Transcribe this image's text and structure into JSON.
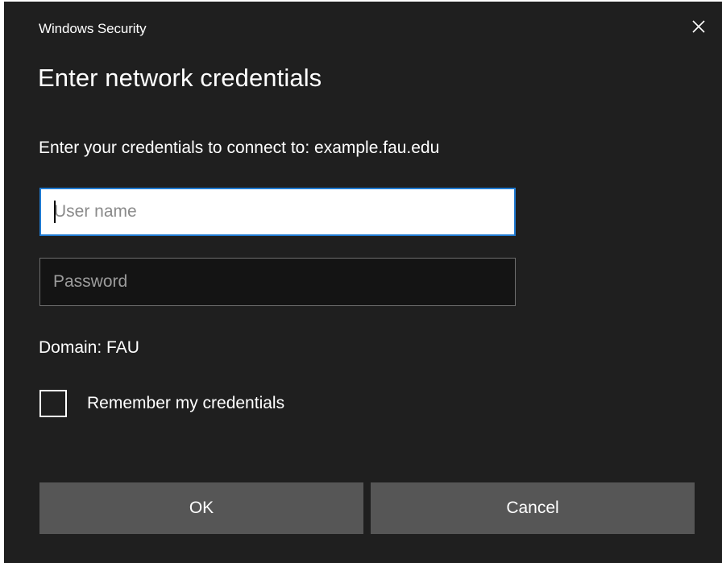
{
  "window": {
    "title": "Windows Security",
    "close_icon": "close-icon"
  },
  "dialog": {
    "heading": "Enter network credentials",
    "prompt": "Enter your credentials to connect to: example.fau.edu",
    "username": {
      "value": "",
      "placeholder": "User name"
    },
    "password": {
      "value": "",
      "placeholder": "Password"
    },
    "domain": "Domain: FAU",
    "remember": {
      "label": "Remember my credentials",
      "checked": false
    },
    "buttons": {
      "ok": "OK",
      "cancel": "Cancel"
    }
  },
  "colors": {
    "background": "#1f1f1f",
    "focus_border": "#1f7ad1",
    "button": "#565656"
  }
}
